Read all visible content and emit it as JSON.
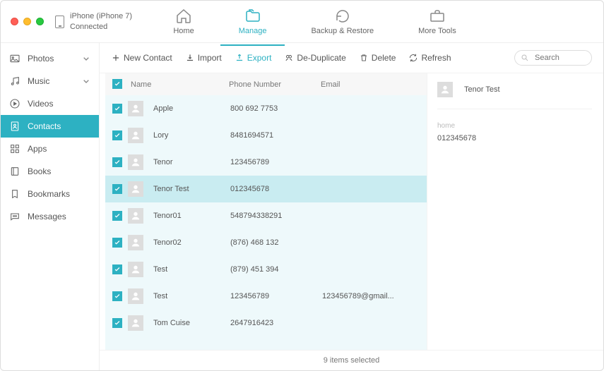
{
  "device": {
    "name": "iPhone (iPhone 7)",
    "status": "Connected"
  },
  "tabs": {
    "home": "Home",
    "manage": "Manage",
    "backup": "Backup & Restore",
    "more": "More Tools"
  },
  "sidebar": {
    "photos": "Photos",
    "music": "Music",
    "videos": "Videos",
    "contacts": "Contacts",
    "apps": "Apps",
    "books": "Books",
    "bookmarks": "Bookmarks",
    "messages": "Messages"
  },
  "toolbar": {
    "new_contact": "New Contact",
    "import": "Import",
    "export": "Export",
    "dedup": "De-Duplicate",
    "delete": "Delete",
    "refresh": "Refresh",
    "search_placeholder": "Search"
  },
  "columns": {
    "name": "Name",
    "phone": "Phone Number",
    "email": "Email"
  },
  "contacts": [
    {
      "name": "Apple",
      "phone": "800 692 7753",
      "email": ""
    },
    {
      "name": "Lory",
      "phone": "8481694571",
      "email": ""
    },
    {
      "name": "Tenor",
      "phone": "123456789",
      "email": ""
    },
    {
      "name": "Tenor Test",
      "phone": "012345678",
      "email": ""
    },
    {
      "name": "Tenor01",
      "phone": "548794338291",
      "email": ""
    },
    {
      "name": "Tenor02",
      "phone": "(876) 468 132",
      "email": ""
    },
    {
      "name": "Test",
      "phone": "(879) 451 394",
      "email": ""
    },
    {
      "name": "Test",
      "phone": "123456789",
      "email": "123456789@gmail..."
    },
    {
      "name": "Tom Cuise",
      "phone": "2647916423",
      "email": ""
    }
  ],
  "detail": {
    "name": "Tenor Test",
    "section_label": "home",
    "phone": "012345678"
  },
  "footer": "9 items selected",
  "selected_row_index": 3
}
